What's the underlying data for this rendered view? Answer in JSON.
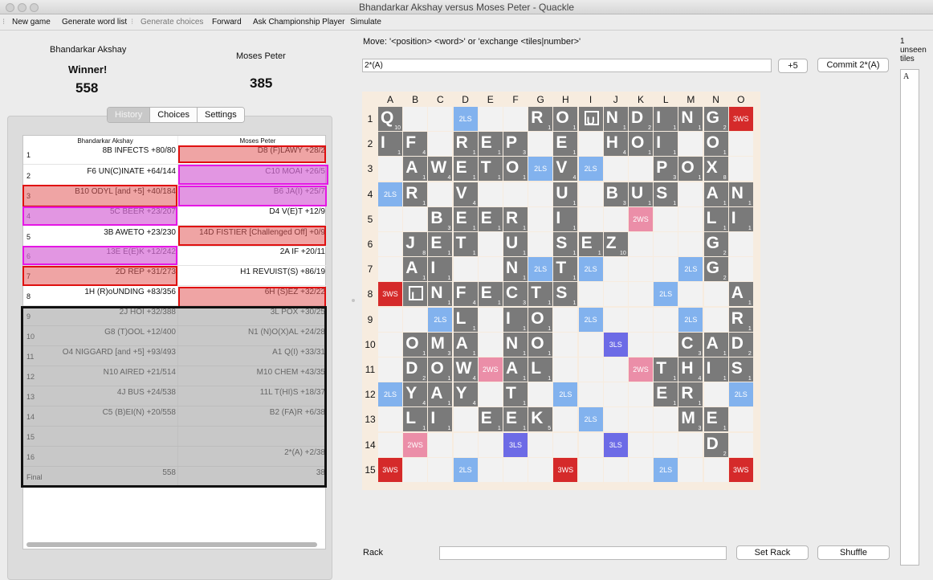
{
  "window": {
    "title": "Bhandarkar Akshay versus Moses Peter - Quackle"
  },
  "toolbar": {
    "new_game": "New game",
    "generate_word_list": "Generate word list",
    "generate_choices": "Generate choices",
    "forward": "Forward",
    "ask_championship": "Ask Championship Player",
    "simulate": "Simulate"
  },
  "players": [
    {
      "name": "Bhandarkar Akshay",
      "status": "Winner!",
      "score": "558"
    },
    {
      "name": "Moses Peter",
      "status": "",
      "score": "385"
    }
  ],
  "tabs": [
    "History",
    "Choices",
    "Settings"
  ],
  "history": {
    "headers": [
      "Bhandarkar Akshay",
      "Moses Peter"
    ],
    "rows": [
      {
        "num": "1",
        "p1": "8B INFECTS  +80/80",
        "p2": "D8 (F)LAWY  +28/2"
      },
      {
        "num": "2",
        "p1": "F6 UN(C)INATE  +64/144",
        "p2": "C10 MOAI  +26/5"
      },
      {
        "num": "3",
        "p1": "B10 ODYL [and +5]  +40/184",
        "p2": "B6 JA(I)  +25/7"
      },
      {
        "num": "4",
        "p1": "5C BEER  +23/207",
        "p2": "D4 V(E)T  +12/9"
      },
      {
        "num": "5",
        "p1": "3B AWETO  +23/230",
        "p2": "14D FISTIER [Challenged Off]  +0/9"
      },
      {
        "num": "6",
        "p1": "13E E(E)K  +12/242",
        "p2": "2A IF  +20/11"
      },
      {
        "num": "7",
        "p1": "2D REP  +31/273",
        "p2": "H1 REVUIST(S)  +86/19"
      },
      {
        "num": "8",
        "p1": "1H (R)oUNDING  +83/356",
        "p2": "6H (S)EZ  +32/22"
      },
      {
        "num": "9",
        "p1": "2J HOI  +32/388",
        "p2": "3L POX  +30/25"
      },
      {
        "num": "10",
        "p1": "G8 (T)OOL  +12/400",
        "p2": "N1 (N)O(X)AL  +24/28"
      },
      {
        "num": "11",
        "p1": "O4 NIGGARD [and +5]  +93/493",
        "p2": "A1 Q(I)  +33/31"
      },
      {
        "num": "12",
        "p1": "N10 AIRED  +21/514",
        "p2": "M10 CHEM  +43/35"
      },
      {
        "num": "13",
        "p1": "4J BUS  +24/538",
        "p2": "11L T(HI)S  +18/37"
      },
      {
        "num": "14",
        "p1": "C5 (B)EI(N)  +20/558",
        "p2": "B2 (FA)R  +6/38"
      },
      {
        "num": "15",
        "p1": "",
        "p2": ""
      },
      {
        "num": "16",
        "p1": "",
        "p2": "2*(A)  +2/38"
      },
      {
        "num": "Final",
        "p1": "558",
        "p2": "38"
      }
    ]
  },
  "move": {
    "label": "Move: '<position> <word>' or 'exchange <tiles|number>'",
    "input": "2*(A)",
    "plus_button": "+5",
    "commit_button": "Commit 2*(A)"
  },
  "board": {
    "cols": [
      "A",
      "B",
      "C",
      "D",
      "E",
      "F",
      "G",
      "H",
      "I",
      "J",
      "K",
      "L",
      "M",
      "N",
      "O"
    ],
    "rows": [
      "1",
      "2",
      "3",
      "4",
      "5",
      "6",
      "7",
      "8",
      "9",
      "10",
      "11",
      "12",
      "13",
      "14",
      "15"
    ],
    "premium_labels": {
      "TW": "3WS",
      "DW": "2WS",
      "TL": "3LS",
      "DL": "2LS"
    },
    "tiles": [
      "Q.....ROUNDING.",
      "IF.REP.E.HOI.O.",
      ".AWETO.V...POX.",
      ".R.V...U.BUS.AN",
      "..BEER.I.....LI",
      ".JET.U.SEZ...G.",
      ".AI..N.T.....G.",
      ".INFECTS......A",
      "...L.IO.......R",
      ".OMA.NO.....CAD",
      ".DOW.AL....THIS",
      ".YAY.T.....ER..",
      ".LI.EEK.....ME.",
      ".............D.",
      "..............."
    ],
    "blanks": [
      "1I",
      "8B"
    ],
    "tile_points": {
      "A": "1",
      "B": "3",
      "C": "3",
      "D": "2",
      "E": "1",
      "F": "4",
      "G": "2",
      "H": "4",
      "I": "1",
      "J": "8",
      "K": "5",
      "L": "1",
      "M": "3",
      "N": "1",
      "O": "1",
      "P": "3",
      "Q": "10",
      "R": "1",
      "S": "1",
      "T": "1",
      "U": "1",
      "V": "4",
      "W": "4",
      "X": "8",
      "Y": "4",
      "Z": "10"
    }
  },
  "rack": {
    "label": "Rack",
    "set_rack": "Set Rack",
    "shuffle": "Shuffle"
  },
  "unseen": {
    "count": "1",
    "label1": "unseen",
    "label2": "tiles",
    "tiles": "A"
  }
}
